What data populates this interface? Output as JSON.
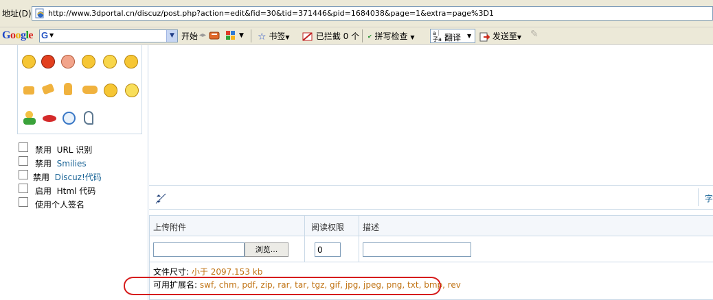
{
  "address_bar": {
    "label": "地址(D)",
    "url": "http://www.3dportal.cn/discuz/post.php?action=edit&fid=30&tid=371446&pid=1684038&page=1&extra=page%3D1"
  },
  "google_toolbar": {
    "logo": "Google",
    "search_engine_glyph": "G",
    "start_label": "开始",
    "bookmarks_label": "书签",
    "popups_blocked_label": "已拦截 0 个",
    "spellcheck_label": "拼写检查",
    "translate_label": "翻译",
    "sendto_label": "发送至"
  },
  "post_options": {
    "disable_url": {
      "prefix": "禁用",
      "text": "URL 识别"
    },
    "disable_smilies": {
      "prefix": "禁用",
      "link": "Smilies"
    },
    "disable_discuz": {
      "prefix": "禁用",
      "link": "Discuz!代码"
    },
    "enable_html": {
      "prefix": "启用",
      "text": "Html 代码"
    },
    "use_signature": {
      "text": "使用个人签名"
    }
  },
  "editor": {
    "right_label": "字"
  },
  "attachments": {
    "col_upload": "上传附件",
    "col_permission": "阅读权限",
    "col_description": "描述",
    "browse_button": "浏览...",
    "permission_value": "0",
    "size_label": "文件尺寸:",
    "size_value": "小于 2097.153 kb",
    "ext_label": "可用扩展名:",
    "ext_value": "swf, chm, pdf, zip, rar, tar, tgz, gif, jpg, jpeg, png, txt, bmp, rev"
  },
  "colors": {
    "accent_link": "#1a6496",
    "info_orange": "#c07212",
    "annotation_red": "#d61c1c"
  }
}
